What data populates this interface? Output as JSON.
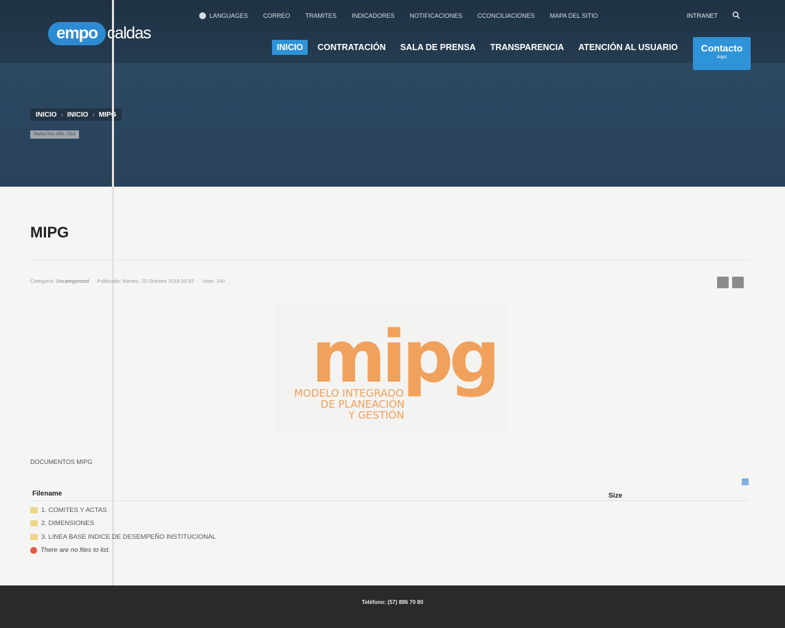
{
  "header": {
    "logo": {
      "brand_left": "empo",
      "brand_right": "caldas"
    },
    "utility_nav": [
      "LANGUAGES",
      "CORREO",
      "TRAMITES",
      "INDICADORES",
      "NOTIFICACIONES",
      "CCONCILIACIONES",
      "MAPA DEL SITIO"
    ],
    "intranet": "INTRANET",
    "main_nav": [
      "INICIO",
      "CONTRATACIÓN",
      "SALA DE PRENSA",
      "TRANSPARENCIA",
      "ATENCIÓN AL USUARIO"
    ],
    "active_nav": "INICIO",
    "contact": {
      "label": "Contacto",
      "sublabel": "Aquí"
    }
  },
  "breadcrumb": [
    "INICIO",
    "INICIO",
    "MIPG"
  ],
  "date_badge": "Martes Nov 20th, 2018",
  "article": {
    "title": "MIPG",
    "meta": {
      "category_label": "Categoría:",
      "category": "Uncategorised",
      "published": "Publicado: Martes, 20 Octubre 2018 05:52",
      "views": "Visto: 140"
    },
    "logo_text": {
      "big": "mipg",
      "line1": "MODELO INTEGRADO",
      "line2": "DE PLANEACIÓN",
      "line3": "Y GESTIÓN"
    }
  },
  "documents": {
    "heading": "DOCUMENTOS MIPG",
    "columns": {
      "filename": "Filename",
      "size": "Size"
    },
    "folders": [
      "1. COMITES Y ACTAS",
      "2. DIMENSIONES",
      "3. LINEA BASE INDICE DE DESEMPEÑO INSTITUCIONAL"
    ],
    "empty_message": "There are no files to list."
  },
  "footer": {
    "phone": "Teléfono: (57) 886 70 80"
  },
  "colors": {
    "accent": "#2f93d8",
    "logo_orange": "#f0a15b",
    "header_bg": "#253b50",
    "footer_bg": "#2a2a2a"
  }
}
